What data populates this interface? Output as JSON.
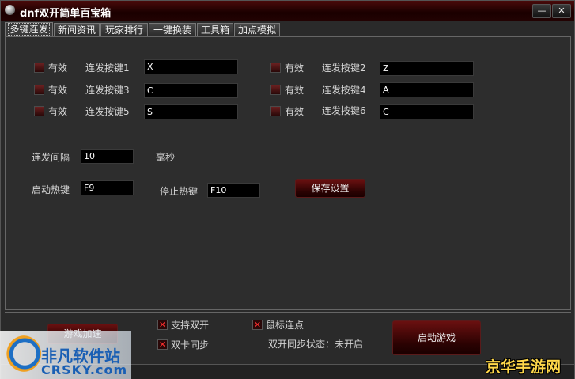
{
  "window": {
    "title": "dnf双开简单百宝箱",
    "minimize_glyph": "—",
    "close_glyph": "✕"
  },
  "tabs": [
    "多键连发",
    "新闻资讯",
    "玩家排行",
    "一键换装",
    "工具箱",
    "加点模拟"
  ],
  "keys": [
    {
      "enable": "有效",
      "label": "连发按键1",
      "value": "X"
    },
    {
      "enable": "有效",
      "label": "连发按键2",
      "value": "Z"
    },
    {
      "enable": "有效",
      "label": "连发按键3",
      "value": "C"
    },
    {
      "enable": "有效",
      "label": "连发按键4",
      "value": "A"
    },
    {
      "enable": "有效",
      "label": "连发按键5",
      "value": "S"
    },
    {
      "enable": "有效",
      "label": "连发按键6",
      "value": "C"
    }
  ],
  "interval": {
    "label": "连发间隔",
    "value": "10",
    "unit": "毫秒"
  },
  "start_hotkey": {
    "label": "启动热键",
    "value": "F9"
  },
  "stop_hotkey": {
    "label": "停止热键",
    "value": "F10"
  },
  "save_button": "保存设置",
  "bottom": {
    "speed_button": "游戏加速",
    "dual_open": "支持双开",
    "dual_card_sync": "双卡同步",
    "mouse_click": "鼠标连点",
    "sync_status": "双开同步状态：未开启",
    "start_game": "启动游戏",
    "check_glyph": "✕"
  },
  "watermarks": {
    "left_text": "非凡软件站",
    "left_sub": "CRSKY.com",
    "right_text": "京华手游网"
  }
}
